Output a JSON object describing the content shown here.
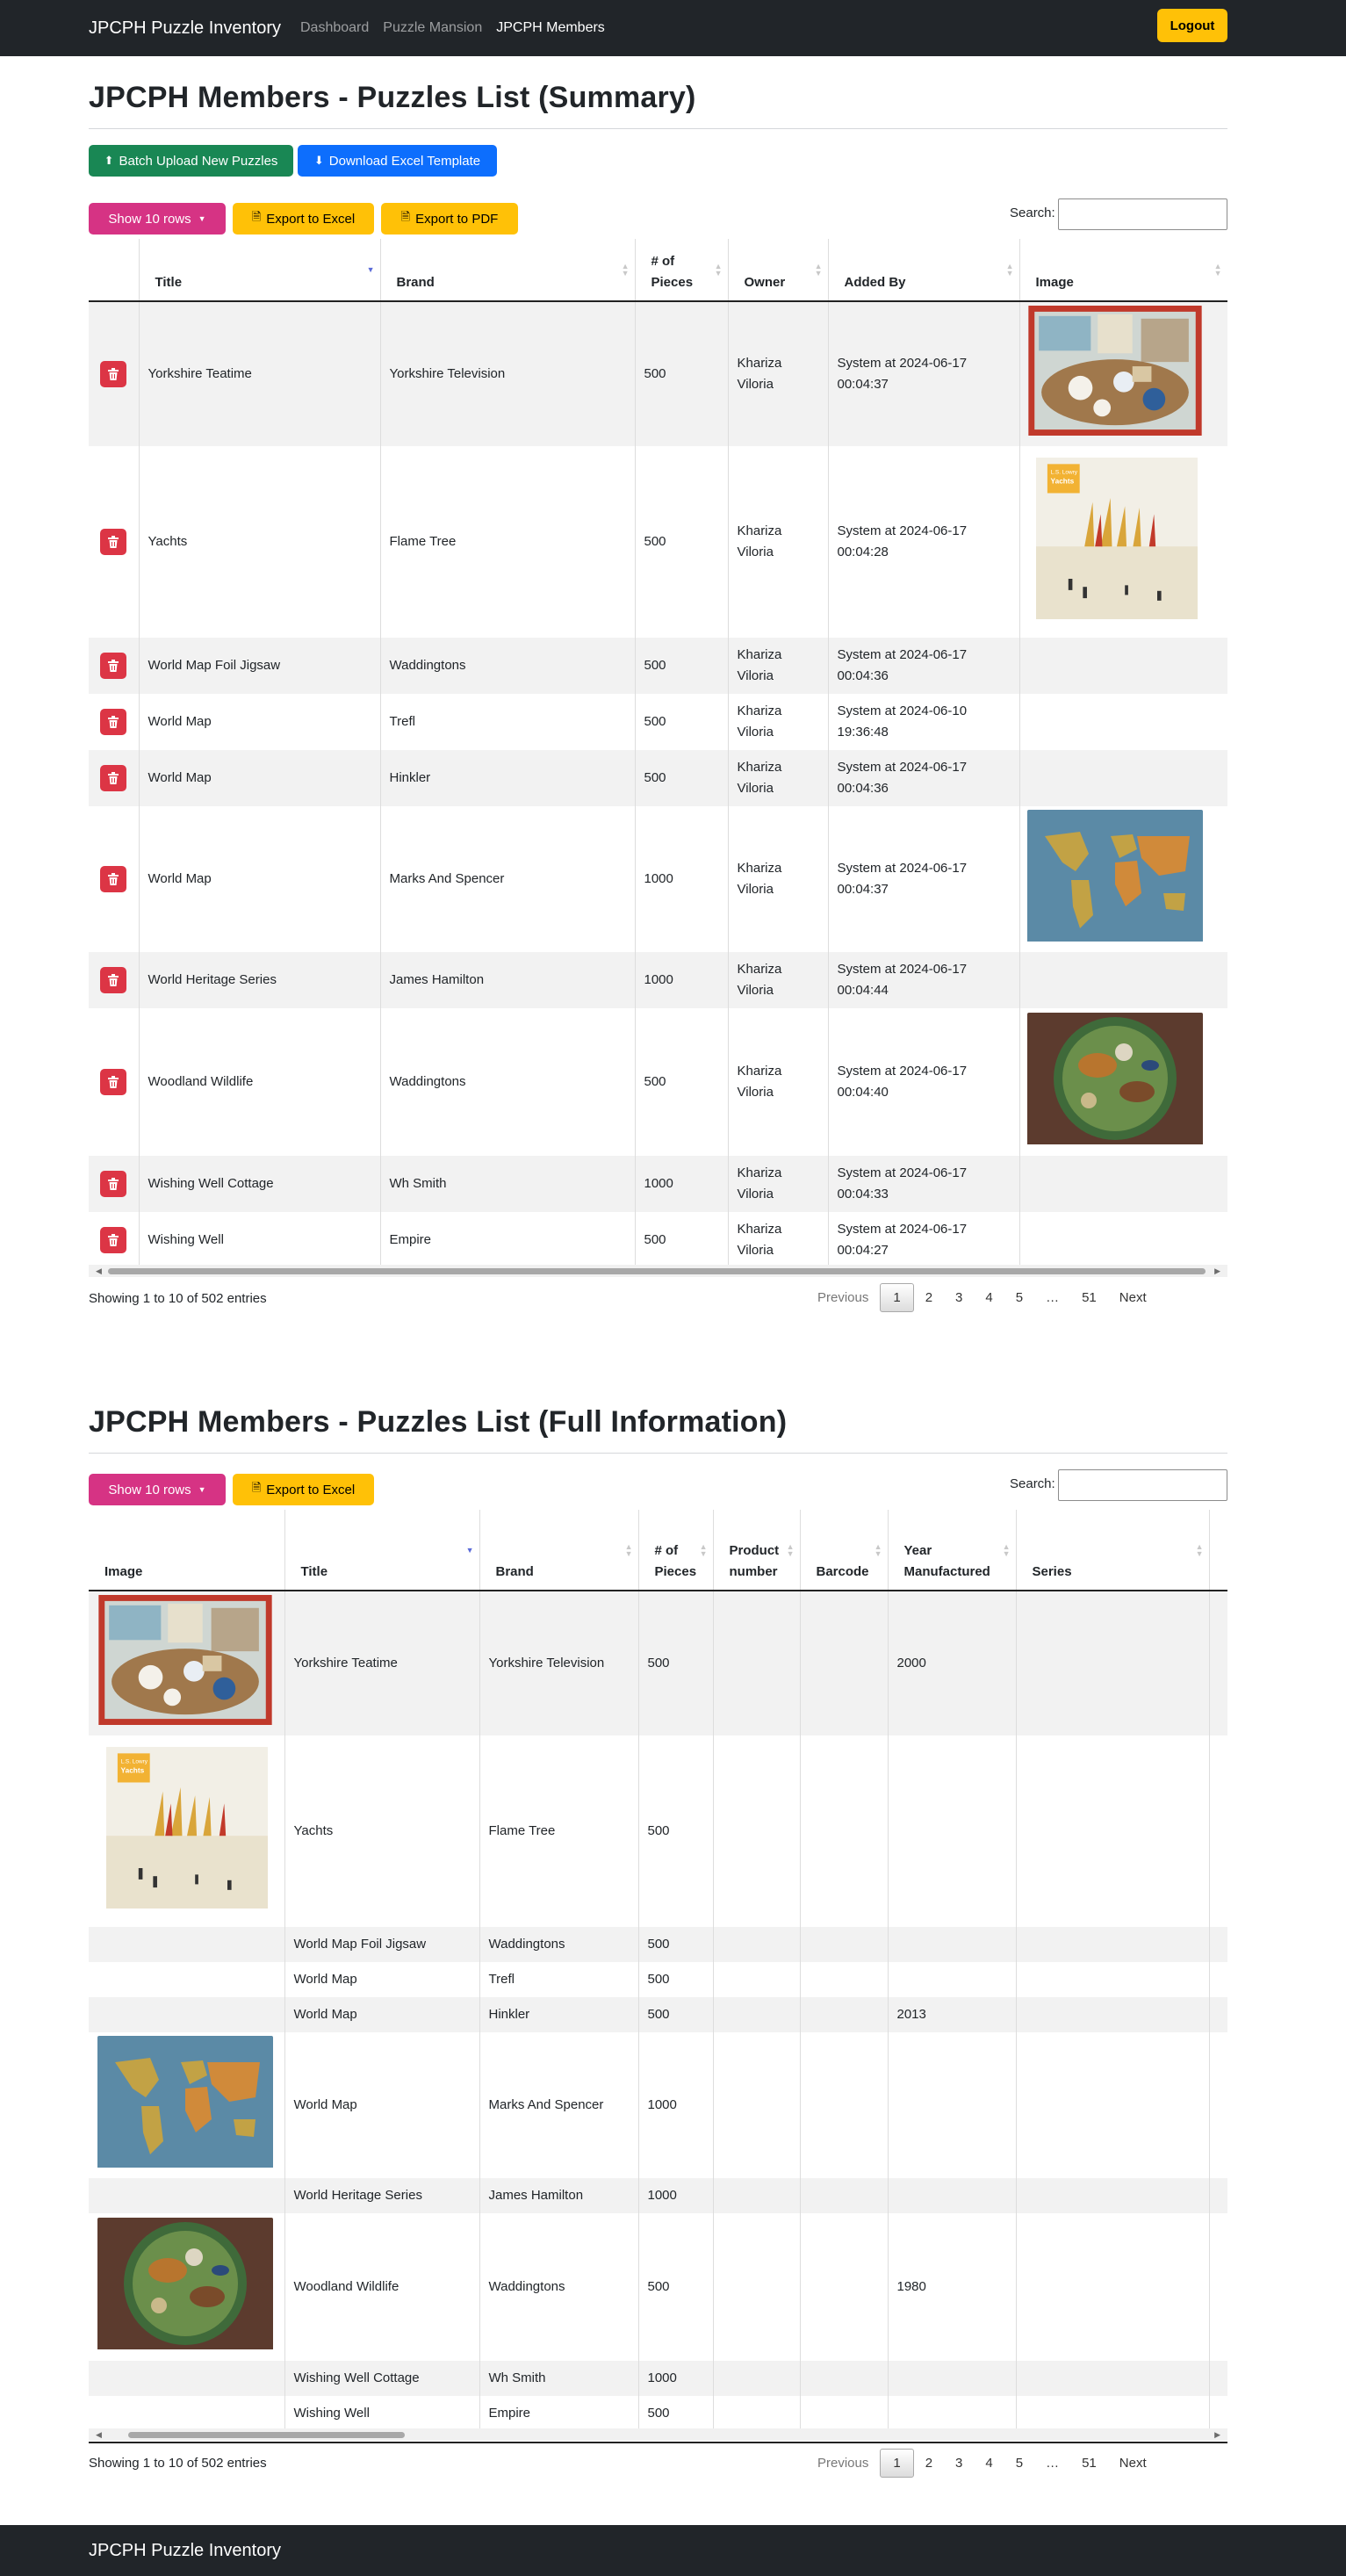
{
  "nav": {
    "brand": "JPCPH Puzzle Inventory",
    "links": [
      "Dashboard",
      "Puzzle Mansion",
      "JPCPH Members"
    ],
    "logout": "Logout"
  },
  "summary": {
    "heading": "JPCPH Members - Puzzles List (Summary)",
    "batch_upload": "Batch Upload New Puzzles",
    "download_template": "Download Excel Template",
    "show_rows": "Show 10 rows",
    "export_excel": "Export to Excel",
    "export_pdf": "Export to PDF",
    "search_label": "Search:",
    "columns": [
      "Title",
      "Brand",
      "# of Pieces",
      "Owner",
      "Added By",
      "Image"
    ],
    "rows": [
      {
        "title": "Yorkshire Teatime",
        "brand": "Yorkshire Television",
        "pieces": "500",
        "owner": "Khariza Viloria",
        "added": "System at 2024-06-17 00:04:37",
        "image": "teatime"
      },
      {
        "title": "Yachts",
        "brand": "Flame Tree",
        "pieces": "500",
        "owner": "Khariza Viloria",
        "added": "System at 2024-06-17 00:04:28",
        "image": "yachts"
      },
      {
        "title": "World Map Foil Jigsaw",
        "brand": "Waddingtons",
        "pieces": "500",
        "owner": "Khariza Viloria",
        "added": "System at 2024-06-17 00:04:36",
        "image": ""
      },
      {
        "title": "World Map",
        "brand": "Trefl",
        "pieces": "500",
        "owner": "Khariza Viloria",
        "added": "System at 2024-06-10 19:36:48",
        "image": ""
      },
      {
        "title": "World Map",
        "brand": "Hinkler",
        "pieces": "500",
        "owner": "Khariza Viloria",
        "added": "System at 2024-06-17 00:04:36",
        "image": ""
      },
      {
        "title": "World Map",
        "brand": "Marks And Spencer",
        "pieces": "1000",
        "owner": "Khariza Viloria",
        "added": "System at 2024-06-17 00:04:37",
        "image": "worldmap"
      },
      {
        "title": "World Heritage Series",
        "brand": "James Hamilton",
        "pieces": "1000",
        "owner": "Khariza Viloria",
        "added": "System at 2024-06-17 00:04:44",
        "image": ""
      },
      {
        "title": "Woodland Wildlife",
        "brand": "Waddingtons",
        "pieces": "500",
        "owner": "Khariza Viloria",
        "added": "System at 2024-06-17 00:04:40",
        "image": "woodland"
      },
      {
        "title": "Wishing Well Cottage",
        "brand": "Wh Smith",
        "pieces": "1000",
        "owner": "Khariza Viloria",
        "added": "System at 2024-06-17 00:04:33",
        "image": ""
      },
      {
        "title": "Wishing Well",
        "brand": "Empire",
        "pieces": "500",
        "owner": "Khariza Viloria",
        "added": "System at 2024-06-17 00:04:27",
        "image": ""
      }
    ],
    "info": "Showing 1 to 10 of 502 entries"
  },
  "full": {
    "heading": "JPCPH Members - Puzzles List (Full Information)",
    "show_rows": "Show 10 rows",
    "export_excel": "Export to Excel",
    "search_label": "Search:",
    "columns": [
      "Image",
      "Title",
      "Brand",
      "# of Pieces",
      "Product number",
      "Barcode",
      "Year Manufactured",
      "Series"
    ],
    "rows": [
      {
        "image": "teatime",
        "title": "Yorkshire Teatime",
        "brand": "Yorkshire Television",
        "pieces": "500",
        "year": "2000"
      },
      {
        "image": "yachts",
        "title": "Yachts",
        "brand": "Flame Tree",
        "pieces": "500",
        "year": ""
      },
      {
        "image": "",
        "title": "World Map Foil Jigsaw",
        "brand": "Waddingtons",
        "pieces": "500",
        "year": ""
      },
      {
        "image": "",
        "title": "World Map",
        "brand": "Trefl",
        "pieces": "500",
        "year": ""
      },
      {
        "image": "",
        "title": "World Map",
        "brand": "Hinkler",
        "pieces": "500",
        "year": "2013"
      },
      {
        "image": "worldmap",
        "title": "World Map",
        "brand": "Marks And Spencer",
        "pieces": "1000",
        "year": ""
      },
      {
        "image": "",
        "title": "World Heritage Series",
        "brand": "James Hamilton",
        "pieces": "1000",
        "year": ""
      },
      {
        "image": "woodland",
        "title": "Woodland Wildlife",
        "brand": "Waddingtons",
        "pieces": "500",
        "year": "1980"
      },
      {
        "image": "",
        "title": "Wishing Well Cottage",
        "brand": "Wh Smith",
        "pieces": "1000",
        "year": ""
      },
      {
        "image": "",
        "title": "Wishing Well",
        "brand": "Empire",
        "pieces": "500",
        "year": ""
      }
    ],
    "info": "Showing 1 to 10 of 502 entries"
  },
  "pagination": {
    "previous": "Previous",
    "pages": [
      "1",
      "2",
      "3",
      "4",
      "5",
      "…",
      "51"
    ],
    "next": "Next"
  },
  "yachts_cover": {
    "artist": "L.S. Lowry",
    "label": "Yachts"
  },
  "footer": "JPCPH Puzzle Inventory",
  "colors": {
    "navbar": "#212529",
    "pink": "#d63384",
    "yellow": "#ffc107",
    "green": "#198754",
    "blue": "#0d6efd",
    "danger": "#dc3545"
  }
}
